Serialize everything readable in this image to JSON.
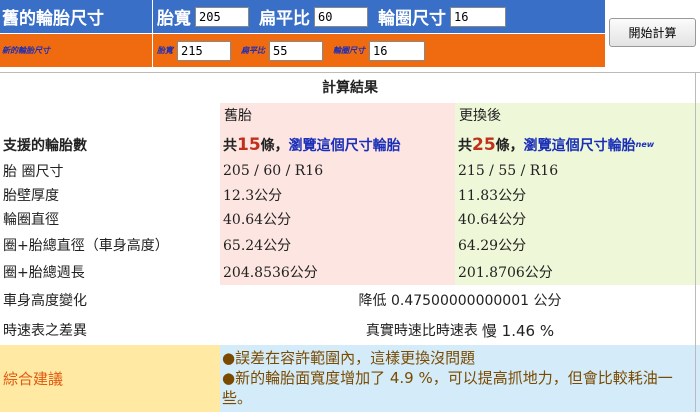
{
  "old_tire": {
    "label": "舊的輪胎尺寸",
    "width_label": "胎寬",
    "width_value": "205",
    "aspect_label": "扁平比",
    "aspect_value": "60",
    "rim_label": "輪圈尺寸",
    "rim_value": "16"
  },
  "new_tire": {
    "label": "新的輪胎尺寸",
    "width_label": "胎寬",
    "width_value": "215",
    "aspect_label": "扁平比",
    "aspect_value": "55",
    "rim_label": "輪圈尺寸",
    "rim_value": "16"
  },
  "calc_button": "開始計算",
  "results": {
    "title": "計算結果",
    "col_old": "舊胎",
    "col_new": "更換後",
    "supported_label": "支援的輪胎數",
    "supported_old": {
      "prefix": "共",
      "count": "15",
      "suffix": "條，",
      "link": "瀏覽這個尺寸輪胎"
    },
    "supported_new": {
      "prefix": "共",
      "count": "25",
      "suffix": "條，",
      "link": "瀏覽這個尺寸輪胎",
      "badge": "new"
    },
    "rows": [
      {
        "label": "胎 圈尺寸",
        "old": "205 / 60 / R16",
        "new": "215 / 55 / R16"
      },
      {
        "label": "胎壁厚度",
        "old": "12.3公分",
        "new": "11.83公分"
      },
      {
        "label": "輪圈直徑",
        "old": "40.64公分",
        "new": "40.64公分"
      },
      {
        "label": "圈+胎總直徑（車身高度）",
        "old": "65.24公分",
        "new": "64.29公分"
      },
      {
        "label": "圈+胎總週長",
        "old": "204.8536公分",
        "new": "201.8706公分"
      }
    ],
    "height_change_label": "車身高度變化",
    "height_change_value": "降低 0.47500000000001 公分",
    "speedo_label": "時速表之差異",
    "speedo_prefix": "真實時速比時速表",
    "speedo_value": "慢 1.46 %",
    "advice_label": "綜合建議",
    "advice_1": "●誤差在容許範圍內，這樣更換沒問題",
    "advice_2": "●新的輪胎面寬度增加了 4.9 %，可以提高抓地力，但會比較耗油一些。"
  }
}
